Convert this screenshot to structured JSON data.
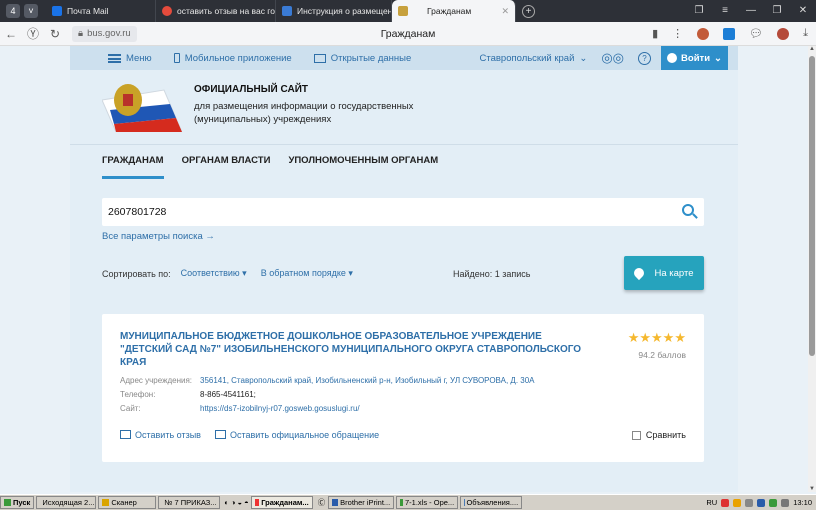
{
  "browser": {
    "tab_count": "4",
    "tabs": [
      {
        "label": "Почта Mail",
        "color": "#1a73e8"
      },
      {
        "label": "оставить отзыв на вас гос",
        "color": "#e54b3c"
      },
      {
        "label": "Инструкция о размещени",
        "color": "#3a7bd5"
      },
      {
        "label": "Гражданам",
        "color": "#c7a13d"
      }
    ],
    "url": "bus.gov.ru",
    "page_title": "Гражданам"
  },
  "topmenu": {
    "menu": "Меню",
    "mobile": "Мобильное приложение",
    "open_data": "Открытые данные",
    "region": "Ставропольский край",
    "login": "Войти"
  },
  "header": {
    "title": "ОФИЦИАЛЬНЫЙ САЙТ",
    "subtitle": "для размещения информации о государственных (муниципальных) учреждениях"
  },
  "nav": {
    "tab1": "ГРАЖДАНАМ",
    "tab2": "ОРГАНАМ ВЛАСТИ",
    "tab3": "УПОЛНОМОЧЕННЫМ ОРГАНАМ"
  },
  "search": {
    "value": "2607801728",
    "all_params": "Все параметры поиска →"
  },
  "sort": {
    "label": "Сортировать по:",
    "by": "Соответствию ▾",
    "order": "В обратном порядке ▾",
    "found": "Найдено: 1 запись",
    "map_button": "На карте"
  },
  "result": {
    "name": "МУНИЦИПАЛЬНОЕ БЮДЖЕТНОЕ ДОШКОЛЬНОЕ ОБРАЗОВАТЕЛЬНОЕ УЧРЕЖДЕНИЕ \"ДЕТСКИЙ САД №7\" ИЗОБИЛЬНЕНСКОГО МУНИЦИПАЛЬНОГО ОКРУГА СТАВРОПОЛЬСКОГО КРАЯ",
    "stars": "★★★★★",
    "rating": 5,
    "score": "94.2 баллов",
    "address_label": "Адрес учреждения:",
    "address": "356141, Ставропольский край, Изобильненский р-н, Изобильный г, УЛ СУВОРОВА, Д. 30А",
    "phone_label": "Телефон:",
    "phone": "8-865-4541161;",
    "site_label": "Сайт:",
    "site": "https://ds7-izobilnyj-r07.gosweb.gosuslugi.ru/",
    "review": "Оставить отзыв",
    "appeal": "Оставить официальное обращение",
    "compare": "Сравнить"
  },
  "taskbar": {
    "start": "Пуск",
    "items": [
      "Исходящая 2...",
      "Сканер",
      "№ 7 ПРИКАЗ...",
      "Гражданам...",
      "Brother iPrint...",
      "7-1.xls - Ope...",
      "Объявления...."
    ],
    "lang": "RU",
    "time": "13:10"
  }
}
